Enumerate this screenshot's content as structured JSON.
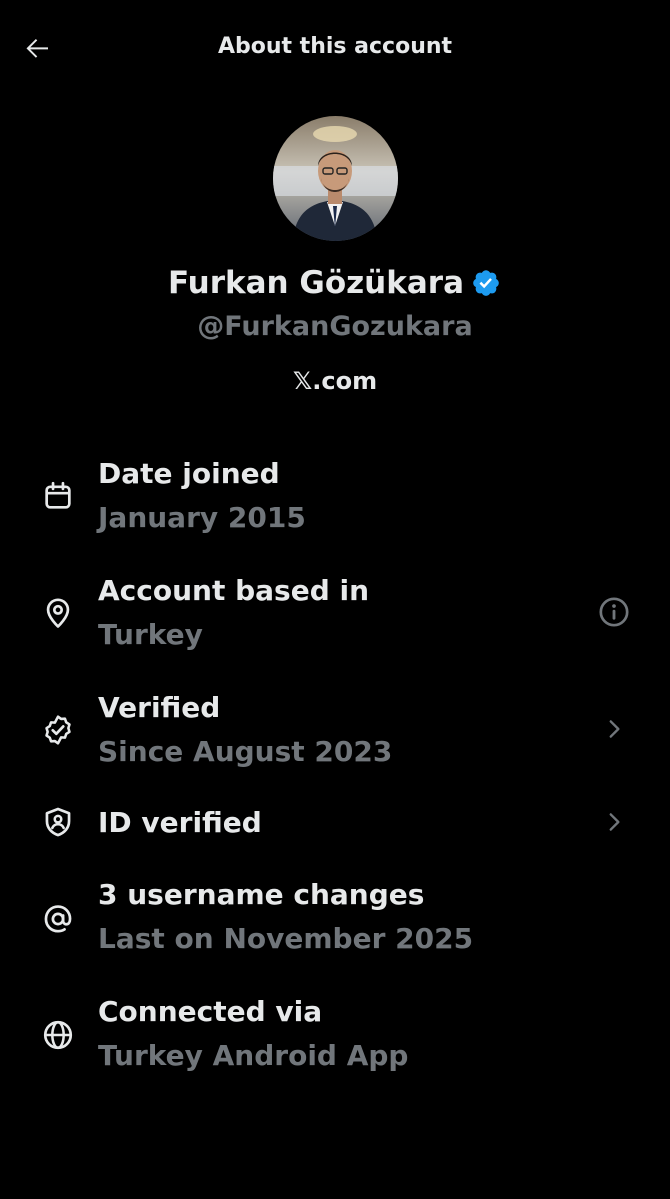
{
  "header": {
    "title": "About this account",
    "back_icon": "arrow-left-icon"
  },
  "profile": {
    "display_name": "Furkan Gözükara",
    "handle": "@FurkanGozukara",
    "site": "𝕏.com",
    "verified_badge_color": "#1d9bf0"
  },
  "rows": [
    {
      "icon": "calendar-icon",
      "title": "Date joined",
      "subtitle": "January 2015",
      "action_icon": null
    },
    {
      "icon": "location-pin-icon",
      "title": "Account based in",
      "subtitle": "Turkey",
      "action_icon": "info-icon"
    },
    {
      "icon": "verified-check-icon",
      "title": "Verified",
      "subtitle": "Since August 2023",
      "action_icon": "chevron-right-icon"
    },
    {
      "icon": "id-shield-icon",
      "title": "ID verified",
      "subtitle": "",
      "action_icon": "chevron-right-icon"
    },
    {
      "icon": "at-sign-icon",
      "title": "3 username changes",
      "subtitle": "Last on November 2025",
      "action_icon": null
    },
    {
      "icon": "globe-icon",
      "title": "Connected via",
      "subtitle": "Turkey Android App",
      "action_icon": null
    }
  ],
  "colors": {
    "background": "#000000",
    "primary_text": "#e7e9ea",
    "secondary_text": "#71767b",
    "accent": "#1d9bf0"
  }
}
